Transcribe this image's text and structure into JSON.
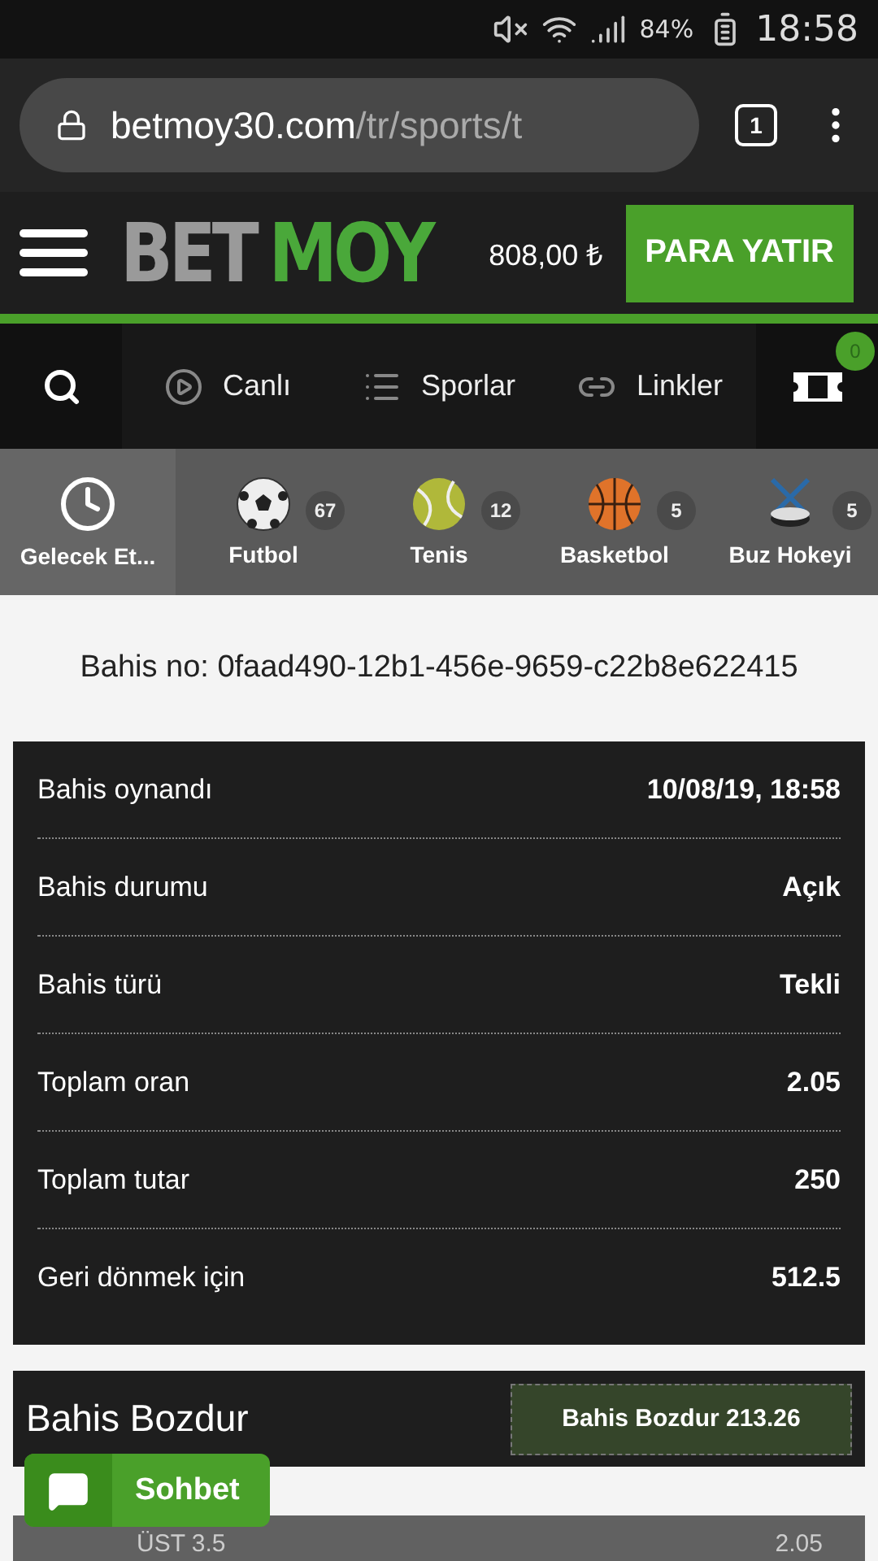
{
  "status_bar": {
    "battery": "84%",
    "time": "18:58"
  },
  "browser": {
    "url_host": "betmoy30.com",
    "url_path": "/tr/sports/t",
    "tab_count": "1"
  },
  "header": {
    "logo_left": "BET",
    "logo_right": "MOY",
    "balance": "808,00 ₺",
    "deposit_button": "PARA YATIR"
  },
  "nav": {
    "items": [
      {
        "kind": "live",
        "label": "Canlı"
      },
      {
        "kind": "sports",
        "label": "Sporlar"
      },
      {
        "kind": "links",
        "label": "Linkler"
      }
    ],
    "betslip_count": "0"
  },
  "sports": [
    {
      "kind": "clock",
      "label": "Gelecek Et...",
      "selected": true
    },
    {
      "kind": "football",
      "label": "Futbol",
      "count": "67",
      "selected": false
    },
    {
      "kind": "tennis",
      "label": "Tenis",
      "count": "12",
      "selected": false
    },
    {
      "kind": "basketball",
      "label": "Basketbol",
      "count": "5",
      "selected": false
    },
    {
      "kind": "hockey",
      "label": "Buz Hokeyi",
      "count": "5",
      "selected": false
    }
  ],
  "bet_number": "Bahis no: 0faad490-12b1-456e-9659-c22b8e622415",
  "details": [
    {
      "label": "Bahis oynandı",
      "value": "10/08/19, 18:58"
    },
    {
      "label": "Bahis durumu",
      "value": "Açık"
    },
    {
      "label": "Bahis türü",
      "value": "Tekli"
    },
    {
      "label": "Toplam oran",
      "value": "2.05"
    },
    {
      "label": "Toplam tutar",
      "value": "250"
    },
    {
      "label": "Geri dönmek için",
      "value": "512.5"
    }
  ],
  "cashout": {
    "title": "Bahis Bozdur",
    "button": "Bahis Bozdur 213.26"
  },
  "selection": {
    "name": "ÜST 3.5",
    "odds": "2.05"
  },
  "chat_button": "Sohbet"
}
